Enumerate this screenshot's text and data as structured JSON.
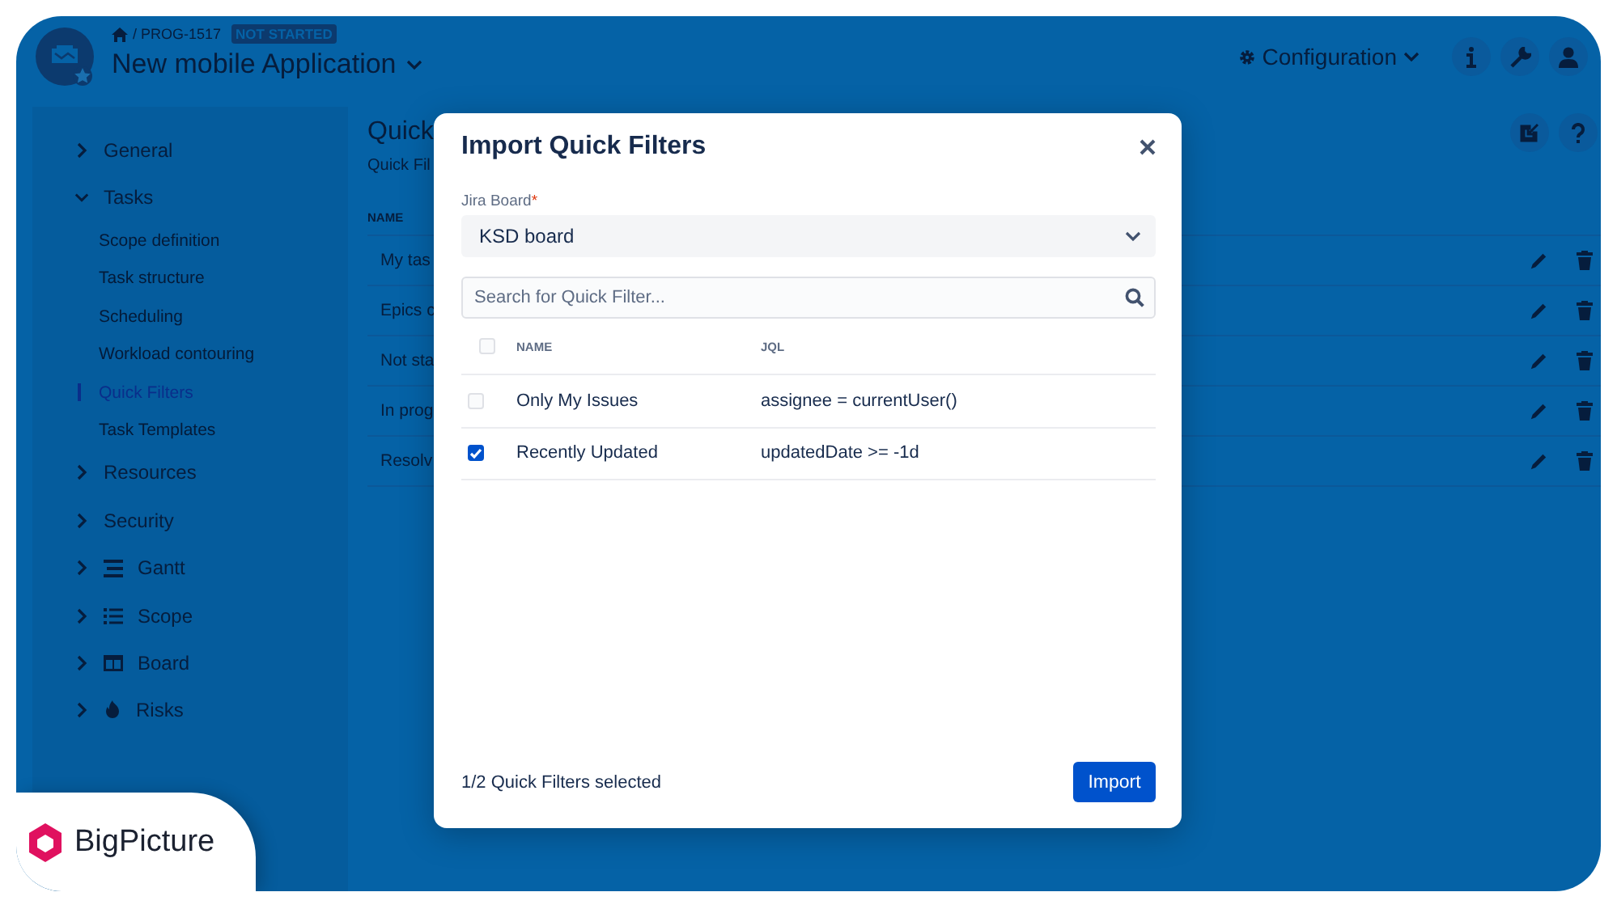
{
  "header": {
    "breadcrumb": "/ PROG-1517",
    "status_badge": "NOT STARTED",
    "project_title": "New mobile Application",
    "config_label": "Configuration"
  },
  "sidebar": {
    "items": [
      {
        "kind": "section",
        "label": "General",
        "expanded": false
      },
      {
        "kind": "section",
        "label": "Tasks",
        "expanded": true,
        "children": [
          {
            "label": "Scope definition",
            "selected": false
          },
          {
            "label": "Task structure",
            "selected": false
          },
          {
            "label": "Scheduling",
            "selected": false
          },
          {
            "label": "Workload contouring",
            "selected": false
          },
          {
            "label": "Quick Filters",
            "selected": true
          },
          {
            "label": "Task Templates",
            "selected": false
          }
        ]
      },
      {
        "kind": "section",
        "label": "Resources",
        "expanded": false
      },
      {
        "kind": "section",
        "label": "Security",
        "expanded": false
      },
      {
        "kind": "gantt",
        "label": "Gantt",
        "expanded": false
      },
      {
        "kind": "scope",
        "label": "Scope",
        "expanded": false
      },
      {
        "kind": "board",
        "label": "Board",
        "expanded": false
      },
      {
        "kind": "risks",
        "label": "Risks",
        "expanded": false
      }
    ]
  },
  "main": {
    "title": "Quick",
    "subtitle": "Quick Fil",
    "column": "NAME",
    "rows": [
      "My tas",
      "Epics c",
      "Not sta",
      "In prog",
      "Resolv"
    ]
  },
  "dialog": {
    "title": "Import Quick Filters",
    "board_label": "Jira Board",
    "required_mark": "*",
    "board_value": "KSD board",
    "search_placeholder": "Search for Quick Filter...",
    "select_all": false,
    "columns": [
      "NAME",
      "JQL"
    ],
    "rows": [
      {
        "name": "Only My Issues",
        "jql": "assignee = currentUser()",
        "checked": false
      },
      {
        "name": "Recently Updated",
        "jql": "updatedDate >= -1d",
        "checked": true
      }
    ],
    "status": "1/2 Quick Filters selected",
    "button": "Import"
  },
  "brand": {
    "name": "BigPicture"
  }
}
